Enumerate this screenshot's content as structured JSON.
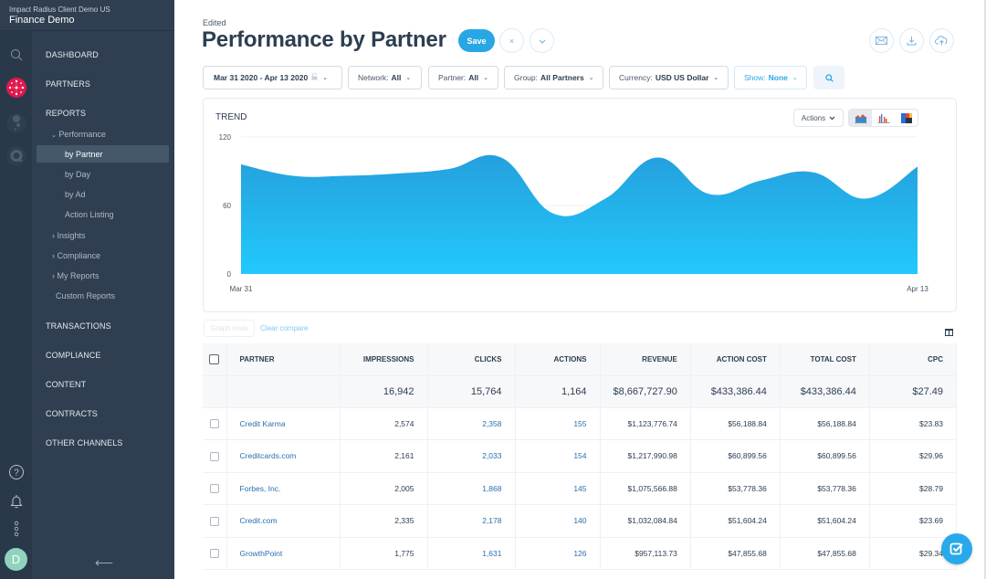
{
  "sidebar": {
    "org_name": "Impact Radius Client Demo US",
    "app_name": "Finance Demo",
    "rail_icons": [
      "search-icon",
      "partners-network-icon",
      "bubbles-icon",
      "q-logo-icon",
      "help-icon",
      "bell-icon",
      "more-icon",
      "avatar"
    ],
    "avatar_initial": "D",
    "avatar_color": "#8fd3bf",
    "items": [
      {
        "label": "DASHBOARD"
      },
      {
        "label": "PARTNERS"
      },
      {
        "label": "REPORTS"
      },
      {
        "label": "TRANSACTIONS"
      },
      {
        "label": "COMPLIANCE"
      },
      {
        "label": "CONTENT"
      },
      {
        "label": "CONTRACTS"
      },
      {
        "label": "OTHER CHANNELS"
      }
    ],
    "reports_sub": {
      "performance": "Performance",
      "performance_items": [
        "by Partner",
        "by Day",
        "by Ad",
        "Action Listing"
      ],
      "insights": "Insights",
      "compliance": "Compliance",
      "my_reports": "My Reports",
      "custom_reports": "Custom Reports"
    },
    "active_item": "by Partner",
    "collapse_glyph": "⟵"
  },
  "header": {
    "status": "Edited",
    "title": "Performance by Partner",
    "save_label": "Save",
    "close_glyph": "×",
    "more_glyph": "⌄",
    "actions": [
      "email-icon",
      "download-icon",
      "cloud-upload-icon"
    ]
  },
  "filters": {
    "date_range": "Mar 31 2020 - Apr 13 2020",
    "network_label": "Network:",
    "network_value": "All",
    "partner_label": "Partner:",
    "partner_value": "All",
    "group_label": "Group:",
    "group_value": "All Partners",
    "currency_label": "Currency:",
    "currency_value": "USD US Dollar",
    "show_label": "Show:",
    "show_value": "None"
  },
  "trend": {
    "title": "TREND",
    "actions_label": "Actions",
    "views": [
      "area-chart-icon",
      "bar-chart-icon",
      "treemap-icon"
    ],
    "active_view": "area-chart-icon"
  },
  "chart_data": {
    "type": "area",
    "title": "TREND",
    "x": [
      "Mar 31",
      "Apr 1",
      "Apr 2",
      "Apr 3",
      "Apr 4",
      "Apr 5",
      "Apr 6",
      "Apr 7",
      "Apr 8",
      "Apr 9",
      "Apr 10",
      "Apr 11",
      "Apr 12",
      "Apr 13"
    ],
    "x_tick_labels": [
      "Mar 31",
      "Apr 13"
    ],
    "series": [
      {
        "name": "Trend",
        "values": [
          96,
          86,
          86,
          88,
          92,
          102,
          53,
          66,
          102,
          70,
          82,
          89,
          66,
          94
        ]
      }
    ],
    "yticks": [
      0,
      60,
      120
    ],
    "ylim": [
      0,
      120
    ],
    "grid": true,
    "legend": "none",
    "color_top": "#24a0dd",
    "color_bottom": "#22c9fc"
  },
  "table_tools": {
    "graph_rows": "Graph rows",
    "clear_compare": "Clear compare"
  },
  "table": {
    "columns": [
      "PARTNER",
      "IMPRESSIONS",
      "CLICKS",
      "ACTIONS",
      "REVENUE",
      "ACTION COST",
      "TOTAL COST",
      "CPC"
    ],
    "totals": [
      "",
      "16,942",
      "15,764",
      "1,164",
      "$8,667,727.90",
      "$433,386.44",
      "$433,386.44",
      "$27.49"
    ],
    "rows": [
      [
        "Credit Karma",
        "2,574",
        "2,358",
        "155",
        "$1,123,776.74",
        "$56,188.84",
        "$56,188.84",
        "$23.83"
      ],
      [
        "Creditcards.com",
        "2,161",
        "2,033",
        "154",
        "$1,217,990.98",
        "$60,899.56",
        "$60,899.56",
        "$29.96"
      ],
      [
        "Forbes, Inc.",
        "2,005",
        "1,868",
        "145",
        "$1,075,566.88",
        "$53,778.36",
        "$53,778.36",
        "$28.79"
      ],
      [
        "Credit.com",
        "2,335",
        "2,178",
        "140",
        "$1,032,084.84",
        "$51,604.24",
        "$51,604.24",
        "$23.69"
      ],
      [
        "GrowthPoint",
        "1,775",
        "1,631",
        "126",
        "$957,113.73",
        "$47,855.68",
        "$47,855.68",
        "$29.34"
      ]
    ]
  },
  "colors": {
    "accent": "#28a7e4",
    "sidebar_bg": "#2f3f51",
    "rail_bg": "#2a3949",
    "link": "#2a6fb0",
    "partners_icon": "#e0194d"
  }
}
